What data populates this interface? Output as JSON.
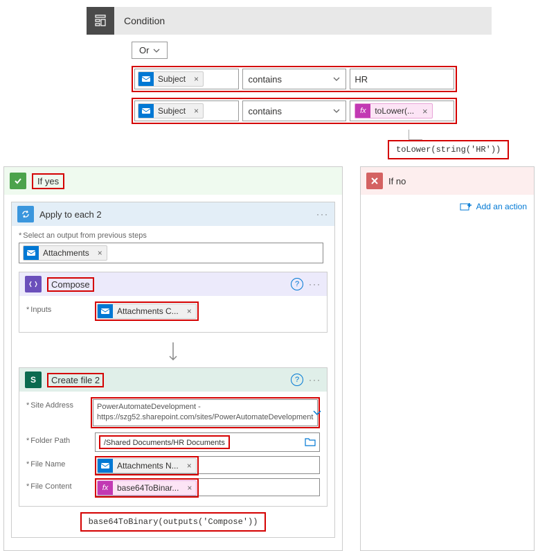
{
  "condition": {
    "title": "Condition",
    "logic": "Or",
    "rows": [
      {
        "token": "Subject",
        "operator": "contains",
        "right_type": "text",
        "right_value": "HR"
      },
      {
        "token": "Subject",
        "operator": "contains",
        "right_type": "fx",
        "right_token": "toLower(..."
      }
    ],
    "callout": "toLower(string('HR'))"
  },
  "yes": {
    "label": "If yes",
    "apply_to_each": {
      "title": "Apply to each 2",
      "select_label": "Select an output from previous steps",
      "select_token": "Attachments"
    },
    "compose": {
      "title": "Compose",
      "inputs_label": "Inputs",
      "inputs_token": "Attachments C..."
    },
    "create_file": {
      "title": "Create file 2",
      "site_label": "Site Address",
      "site_text": "PowerAutomateDevelopment -\nhttps://szg52.sharepoint.com/sites/PowerAutomateDevelopment",
      "folder_label": "Folder Path",
      "folder_value": "/Shared Documents/HR Documents",
      "filename_label": "File Name",
      "filename_token": "Attachments N...",
      "content_label": "File Content",
      "content_token": "base64ToBinar...",
      "callout": "base64ToBinary(outputs('Compose'))"
    }
  },
  "no": {
    "label": "If no",
    "add_action": "Add an action"
  },
  "icons": {
    "fx": "fx",
    "sp": "S",
    "x": "×",
    "help": "?",
    "more": "···"
  }
}
